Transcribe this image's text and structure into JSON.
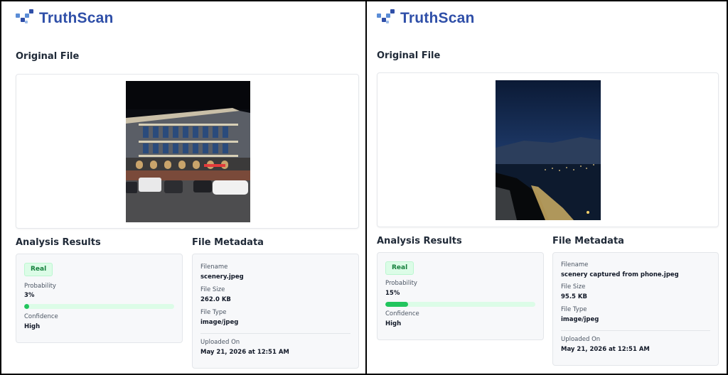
{
  "brand": {
    "name": "TruthScan",
    "accent": "#2f4fa8",
    "icon": "pixel-logo-icon"
  },
  "colors": {
    "real_badge_bg": "#dcfce7",
    "real_badge_text": "#15803d",
    "bar_fill": "#22c55e",
    "bar_track": "#dcfce7"
  },
  "panels": [
    {
      "original_file_title": "Original File",
      "image": {
        "alt": "Night photo of a lit building with parked cars",
        "icon": "building-night-photo"
      },
      "analysis": {
        "title": "Analysis Results",
        "verdict": "Real",
        "probability_label": "Probability",
        "probability_text": "3%",
        "probability_value": 0.03,
        "confidence_label": "Confidence",
        "confidence_value": "High"
      },
      "metadata": {
        "title": "File Metadata",
        "filename_label": "Filename",
        "filename": "scenery.jpeg",
        "size_label": "File Size",
        "size": "262.0 KB",
        "type_label": "File Type",
        "type": "image/jpeg",
        "uploaded_label": "Uploaded On",
        "uploaded": "May 21, 2026 at 12:51 AM"
      }
    },
    {
      "original_file_title": "Original File",
      "image": {
        "alt": "Night landscape of a coastal city from a hillside",
        "icon": "night-landscape-photo"
      },
      "analysis": {
        "title": "Analysis Results",
        "verdict": "Real",
        "probability_label": "Probability",
        "probability_text": "15%",
        "probability_value": 0.15,
        "confidence_label": "Confidence",
        "confidence_value": "High"
      },
      "metadata": {
        "title": "File Metadata",
        "filename_label": "Filename",
        "filename": "scenery captured from phone.jpeg",
        "size_label": "File Size",
        "size": "95.5 KB",
        "type_label": "File Type",
        "type": "image/jpeg",
        "uploaded_label": "Uploaded On",
        "uploaded": "May 21, 2026 at 12:51 AM"
      }
    }
  ]
}
